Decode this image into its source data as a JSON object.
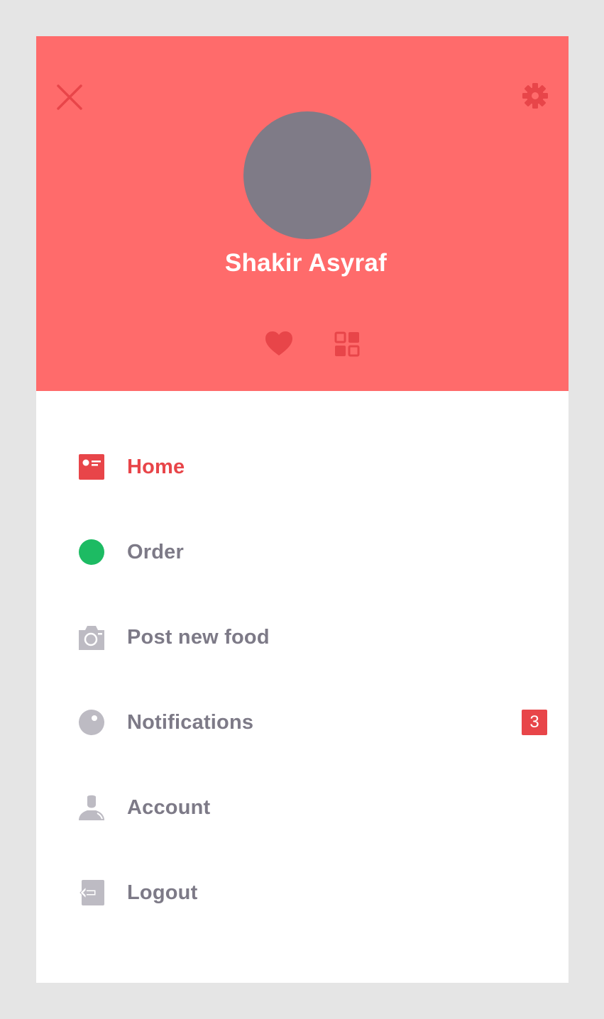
{
  "colors": {
    "background": "#e5e5e5",
    "header": "#ff6b6b",
    "accent": "#e84549",
    "avatar": "#7f7b87",
    "text_muted": "#7d7a87",
    "icon_muted": "#bdbbc3",
    "online": "#1dbb63"
  },
  "header": {
    "close_icon": "close-icon",
    "settings_icon": "gear-icon",
    "profile_name": "Shakir Asyraf",
    "actions": [
      {
        "icon": "heart-icon"
      },
      {
        "icon": "grid-icon"
      }
    ]
  },
  "menu": {
    "items": [
      {
        "label": "Home",
        "icon": "home-icon",
        "active": true
      },
      {
        "label": "Order",
        "icon": "order-status-dot-icon"
      },
      {
        "label": "Post new food",
        "icon": "camera-icon"
      },
      {
        "label": "Notifications",
        "icon": "notification-bubble-icon",
        "badge": "3"
      },
      {
        "label": "Account",
        "icon": "user-icon"
      },
      {
        "label": "Logout",
        "icon": "logout-icon"
      }
    ]
  }
}
